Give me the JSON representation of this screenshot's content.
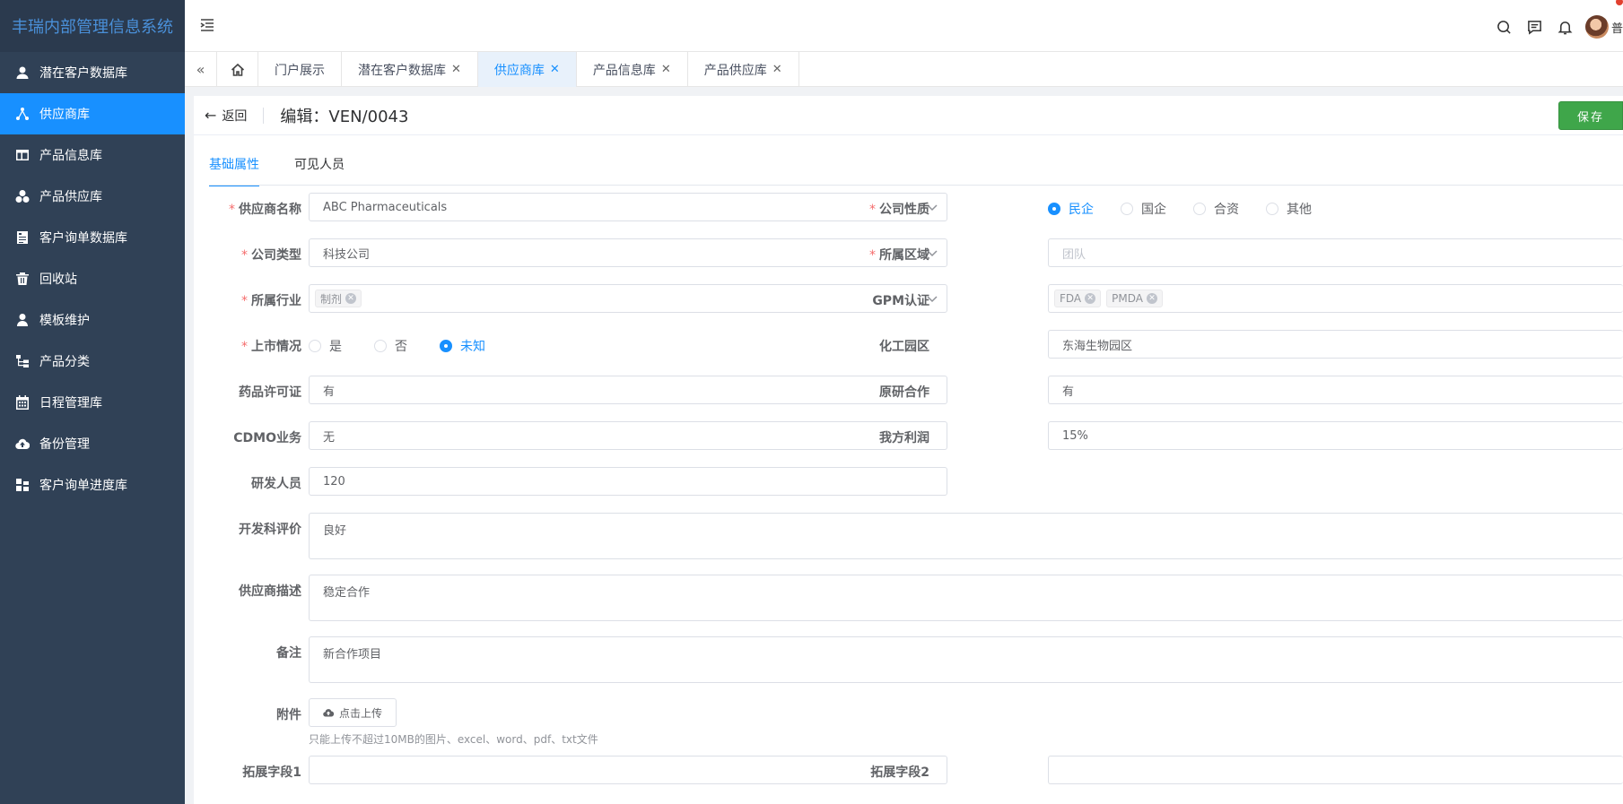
{
  "app": {
    "title": "丰瑞内部管理信息系统",
    "user_name": "普"
  },
  "sidebar": {
    "items": [
      {
        "label": "潜在客户数据库",
        "icon": "user-group-icon",
        "active": false
      },
      {
        "label": "供应商库",
        "icon": "network-icon",
        "active": true
      },
      {
        "label": "产品信息库",
        "icon": "table-icon",
        "active": false
      },
      {
        "label": "产品供应库",
        "icon": "cubes-icon",
        "active": false
      },
      {
        "label": "客户询单数据库",
        "icon": "form-icon",
        "active": false
      },
      {
        "label": "回收站",
        "icon": "trash-icon",
        "active": false
      },
      {
        "label": "模板维护",
        "icon": "person-icon",
        "active": false
      },
      {
        "label": "产品分类",
        "icon": "tree-icon",
        "active": false
      },
      {
        "label": "日程管理库",
        "icon": "calendar-icon",
        "active": false
      },
      {
        "label": "备份管理",
        "icon": "cloud-upload-icon",
        "active": false
      },
      {
        "label": "客户询单进度库",
        "icon": "progress-icon",
        "active": false
      }
    ]
  },
  "tabs": [
    {
      "label": "门户展示",
      "closable": false,
      "active": false
    },
    {
      "label": "潜在客户数据库",
      "closable": true,
      "active": false
    },
    {
      "label": "供应商库",
      "closable": true,
      "active": true
    },
    {
      "label": "产品信息库",
      "closable": true,
      "active": false
    },
    {
      "label": "产品供应库",
      "closable": true,
      "active": false
    }
  ],
  "page": {
    "back_label": "返回",
    "title": "编辑：VEN/0043",
    "save_label": "保存"
  },
  "form_tabs": [
    "基础属性",
    "可见人员"
  ],
  "form": {
    "supplier_name": {
      "label": "供应商名称",
      "value": "ABC Pharmaceuticals",
      "required": true
    },
    "company_nature": {
      "label": "公司性质",
      "required": true,
      "options": [
        "民企",
        "国企",
        "合资",
        "其他"
      ],
      "selected": "民企"
    },
    "company_type": {
      "label": "公司类型",
      "value": "科技公司",
      "required": true
    },
    "region": {
      "label": "所属区域",
      "placeholder": "团队",
      "required": true
    },
    "industry": {
      "label": "所属行业",
      "tags": [
        "制剂"
      ],
      "required": true
    },
    "gpm": {
      "label": "GPM认证",
      "tags": [
        "FDA",
        "PMDA"
      ]
    },
    "listing": {
      "label": "上市情况",
      "required": true,
      "options": [
        "是",
        "否",
        "未知"
      ],
      "selected": "未知"
    },
    "chem_park": {
      "label": "化工园区",
      "value": "东海生物园区"
    },
    "drug_license": {
      "label": "药品许可证",
      "value": "有"
    },
    "original_coop": {
      "label": "原研合作",
      "value": "有"
    },
    "cdmo": {
      "label": "CDMO业务",
      "value": "无"
    },
    "our_profit": {
      "label": "我方利润",
      "value": "15%"
    },
    "rd_staff": {
      "label": "研发人员",
      "value": "120"
    },
    "dev_eval": {
      "label": "开发科评价",
      "value": "良好"
    },
    "supplier_desc": {
      "label": "供应商描述",
      "value": "稳定合作"
    },
    "remark": {
      "label": "备注",
      "value": "新合作项目"
    },
    "attachment": {
      "label": "附件",
      "button": "点击上传",
      "hint": "只能上传不超过10MB的图片、excel、word、pdf、txt文件"
    },
    "ext1": {
      "label": "拓展字段1",
      "value": ""
    },
    "ext2": {
      "label": "拓展字段2",
      "value": ""
    }
  },
  "colors": {
    "sidebar_bg": "#304156",
    "accent": "#1890ff",
    "save_green": "#3fa64a",
    "required": "#f56c6c"
  }
}
